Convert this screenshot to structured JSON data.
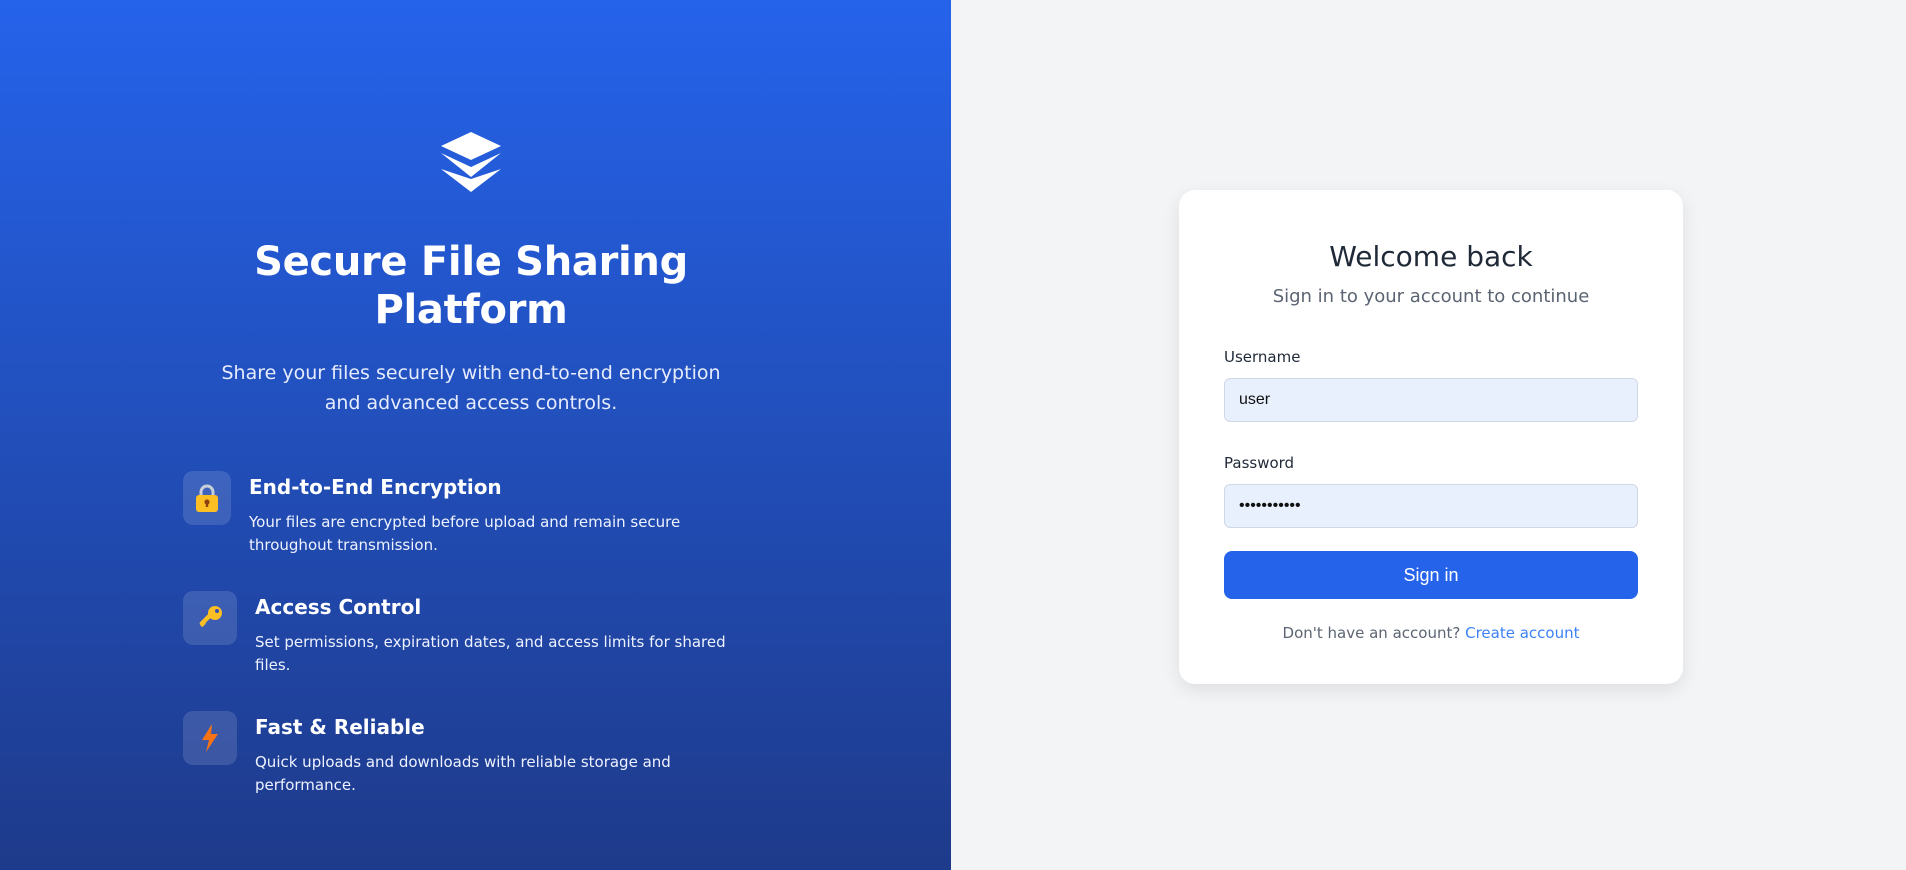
{
  "hero": {
    "logo_icon": "layers-icon",
    "title": "Secure File Sharing Platform",
    "subtitle": "Share your files securely with end-to-end encryption and advanced access controls.",
    "features": [
      {
        "icon": "lock-icon",
        "title": "End-to-End Encryption",
        "description": "Your files are encrypted before upload and remain secure throughout transmission."
      },
      {
        "icon": "key-icon",
        "title": "Access Control",
        "description": "Set permissions, expiration dates, and access limits for shared files."
      },
      {
        "icon": "lightning-icon",
        "title": "Fast & Reliable",
        "description": "Quick uploads and downloads with reliable storage and performance."
      }
    ]
  },
  "login": {
    "title": "Welcome back",
    "subtitle": "Sign in to your account to continue",
    "username_label": "Username",
    "username_value": "user",
    "password_label": "Password",
    "password_value": "password123",
    "submit_label": "Sign in",
    "signup_prompt": "Don't have an account?",
    "signup_link": "Create account"
  },
  "colors": {
    "accent": "#2563eb",
    "hero_gradient_top": "#2563eb",
    "hero_gradient_bottom": "#1e3a8a",
    "link": "#3b82f6",
    "background": "#f3f4f6"
  }
}
